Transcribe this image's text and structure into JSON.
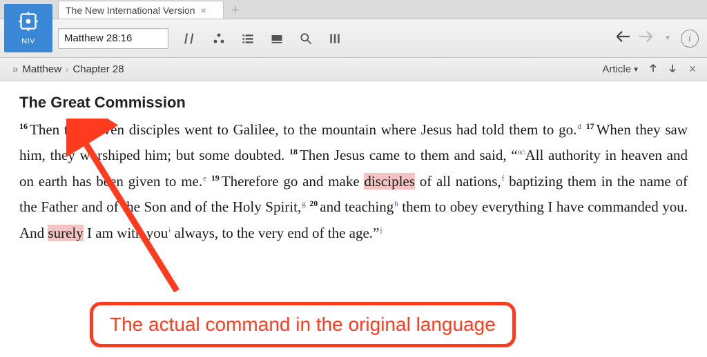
{
  "app": {
    "tile_label": "NIV",
    "tab_title": "The New International Version"
  },
  "toolbar": {
    "reference_value": "Matthew 28:16"
  },
  "breadcrumb": {
    "book": "Matthew",
    "chapter": "Chapter 28",
    "view_mode": "Article"
  },
  "content": {
    "heading": "The Great Commission",
    "verses": {
      "v16_num": "16",
      "v16": "Then the eleven disciples went to Galilee, to the mountain where Jesus had told them to go.",
      "fn_d": "d",
      "v17_num": "17",
      "v17": "When they saw him, they worshiped him; but some doubted.",
      "v18_num": "18",
      "v18_a": "Then Jesus came to them and said, “",
      "v18_b": "All authority in heaven and on earth has been given to me.",
      "fn_e": "e",
      "v19_num": "19",
      "v19_pre_hl": "Therefore go and make ",
      "v19_hl": "disciples",
      "v19_post_hl": " of all nations,",
      "fn_f": "f",
      "v19_tail": " baptizing them in the name of the Father and of the Son and of the Holy Spirit,",
      "fn_g": "g",
      "v20_num": "20",
      "v20_a": "and teaching",
      "fn_h": "h",
      "v20_b": " them to obey everything I have commanded you. And ",
      "v20_hl": "surely",
      "v20_c": " I am with you",
      "fn_i": "i",
      "v20_d": " always, to the very end of the age.”",
      "fn_j": "j"
    }
  },
  "annotation": {
    "text": "The actual command in the original language"
  }
}
